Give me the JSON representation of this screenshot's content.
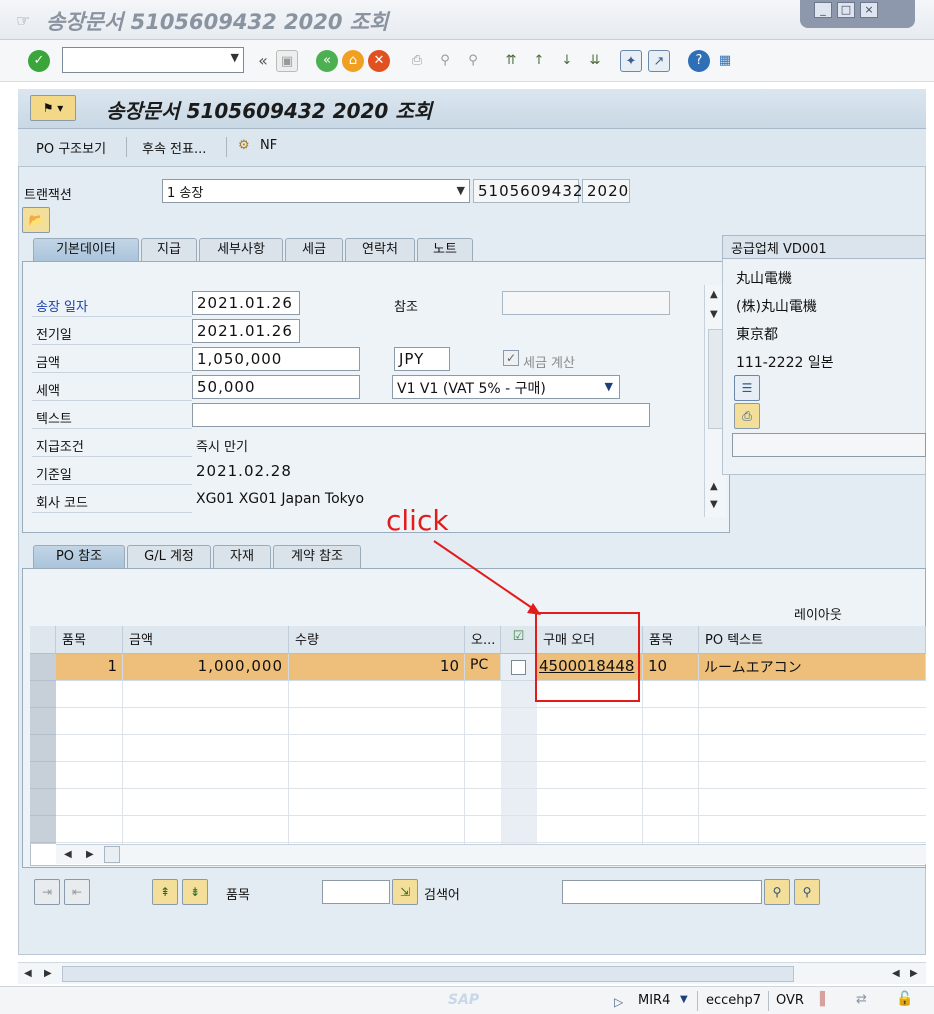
{
  "window": {
    "title": "송장문서 5105609432 2020 조회",
    "controls": [
      "_",
      "□",
      "×"
    ]
  },
  "toolbar": {
    "command_value": "",
    "icons": [
      "check-icon",
      "back-icon",
      "save-icon",
      "prev-icon",
      "exit-icon",
      "cancel-icon",
      "print-icon",
      "find-icon",
      "find-next-icon",
      "first-page-icon",
      "prev-page-icon",
      "next-page-icon",
      "last-page-icon",
      "new-session-icon",
      "shortcut-icon",
      "help-icon",
      "layout-icon"
    ]
  },
  "screen": {
    "title": "송장문서 5105609432 2020 조회",
    "app_buttons": {
      "po_structure": "PO 구조보기",
      "followup": "후속 전표...",
      "nf": "NF"
    }
  },
  "transaction": {
    "label": "트랜잭션",
    "value": "1 송장",
    "doc_number": "5105609432",
    "year": "2020"
  },
  "header_tabs": [
    "기본데이터",
    "지급",
    "세부사항",
    "세금",
    "연락처",
    "노트"
  ],
  "basic_data": {
    "invoice_date_label": "송장 일자",
    "invoice_date": "2021.01.26",
    "posting_date_label": "전기일",
    "posting_date": "2021.01.26",
    "amount_label": "금액",
    "amount": "1,050,000",
    "currency": "JPY",
    "calc_tax_label": "세금 계산",
    "tax_label": "세액",
    "tax_amount": "50,000",
    "tax_code": "V1 V1 (VAT 5% - 구매)",
    "text_label": "텍스트",
    "text_value": "",
    "reference_label": "참조",
    "reference_value": "",
    "payment_terms_label": "지급조건",
    "payment_terms": "즉시 만기",
    "baseline_label": "기준일",
    "baseline_date": "2021.02.28",
    "company_label": "회사 코드",
    "company_code": "XG01 XG01 Japan Tokyo"
  },
  "vendor": {
    "header": "공급업체 VD001",
    "line1": "丸山電機",
    "line2": "(株)丸山電機",
    "line3": "東京都",
    "line4": "111-2222 일본"
  },
  "item_tabs": [
    "PO 참조",
    "G/L 계정",
    "자재",
    "계약 참조"
  ],
  "items": {
    "layout_label": "레이아웃",
    "columns": [
      "품목",
      "금액",
      "수량",
      "오...",
      "",
      "구매 오더",
      "품목",
      "PO 텍스트"
    ],
    "rows": [
      {
        "item": "1",
        "amount": "1,000,000",
        "qty": "10",
        "unit": "PC",
        "po": "4500018448",
        "po_item": "10",
        "text": "ルームエアコン"
      }
    ]
  },
  "bottom_bar": {
    "item_label": "품목",
    "search_label": "검색어"
  },
  "annotation": {
    "text": "click"
  },
  "statusbar": {
    "sap": "SAP",
    "tcode": "MIR4",
    "system": "eccehp7",
    "mode": "OVR"
  }
}
